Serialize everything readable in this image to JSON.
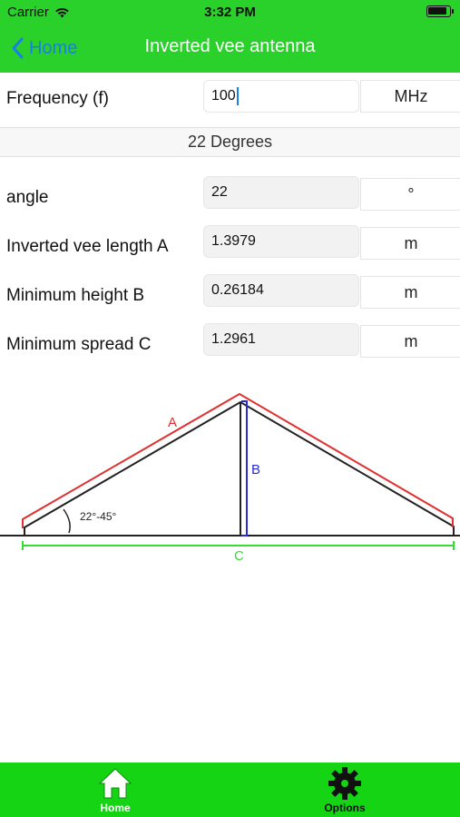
{
  "status_bar": {
    "carrier": "Carrier",
    "time": "3:32 PM"
  },
  "nav": {
    "back_label": "Home",
    "title": "Inverted vee antenna"
  },
  "frequency": {
    "label": "Frequency (f)",
    "value": "100",
    "unit": "MHz"
  },
  "mode_text": "22 Degrees",
  "results": [
    {
      "label": "angle",
      "value": "22",
      "unit": "°"
    },
    {
      "label": "Inverted vee length A",
      "value": "1.3979",
      "unit": "m"
    },
    {
      "label": "Minimum height B",
      "value": "0.26184",
      "unit": "m"
    },
    {
      "label": "Minimum spread C",
      "value": "1.2961",
      "unit": "m"
    }
  ],
  "diagram": {
    "label_a": "A",
    "label_b": "B",
    "label_c": "C",
    "angle_range": "22°-45°",
    "colors": {
      "a": "#e03030",
      "b": "#2b2bd6",
      "c": "#33dd33",
      "wire": "#222222"
    }
  },
  "tabbar": {
    "home_label": "Home",
    "options_label": "Options",
    "colors": {
      "background": "#14d414"
    }
  },
  "theme": {
    "nav_green": "#2ad12a",
    "link_blue": "#1a7fe6"
  }
}
